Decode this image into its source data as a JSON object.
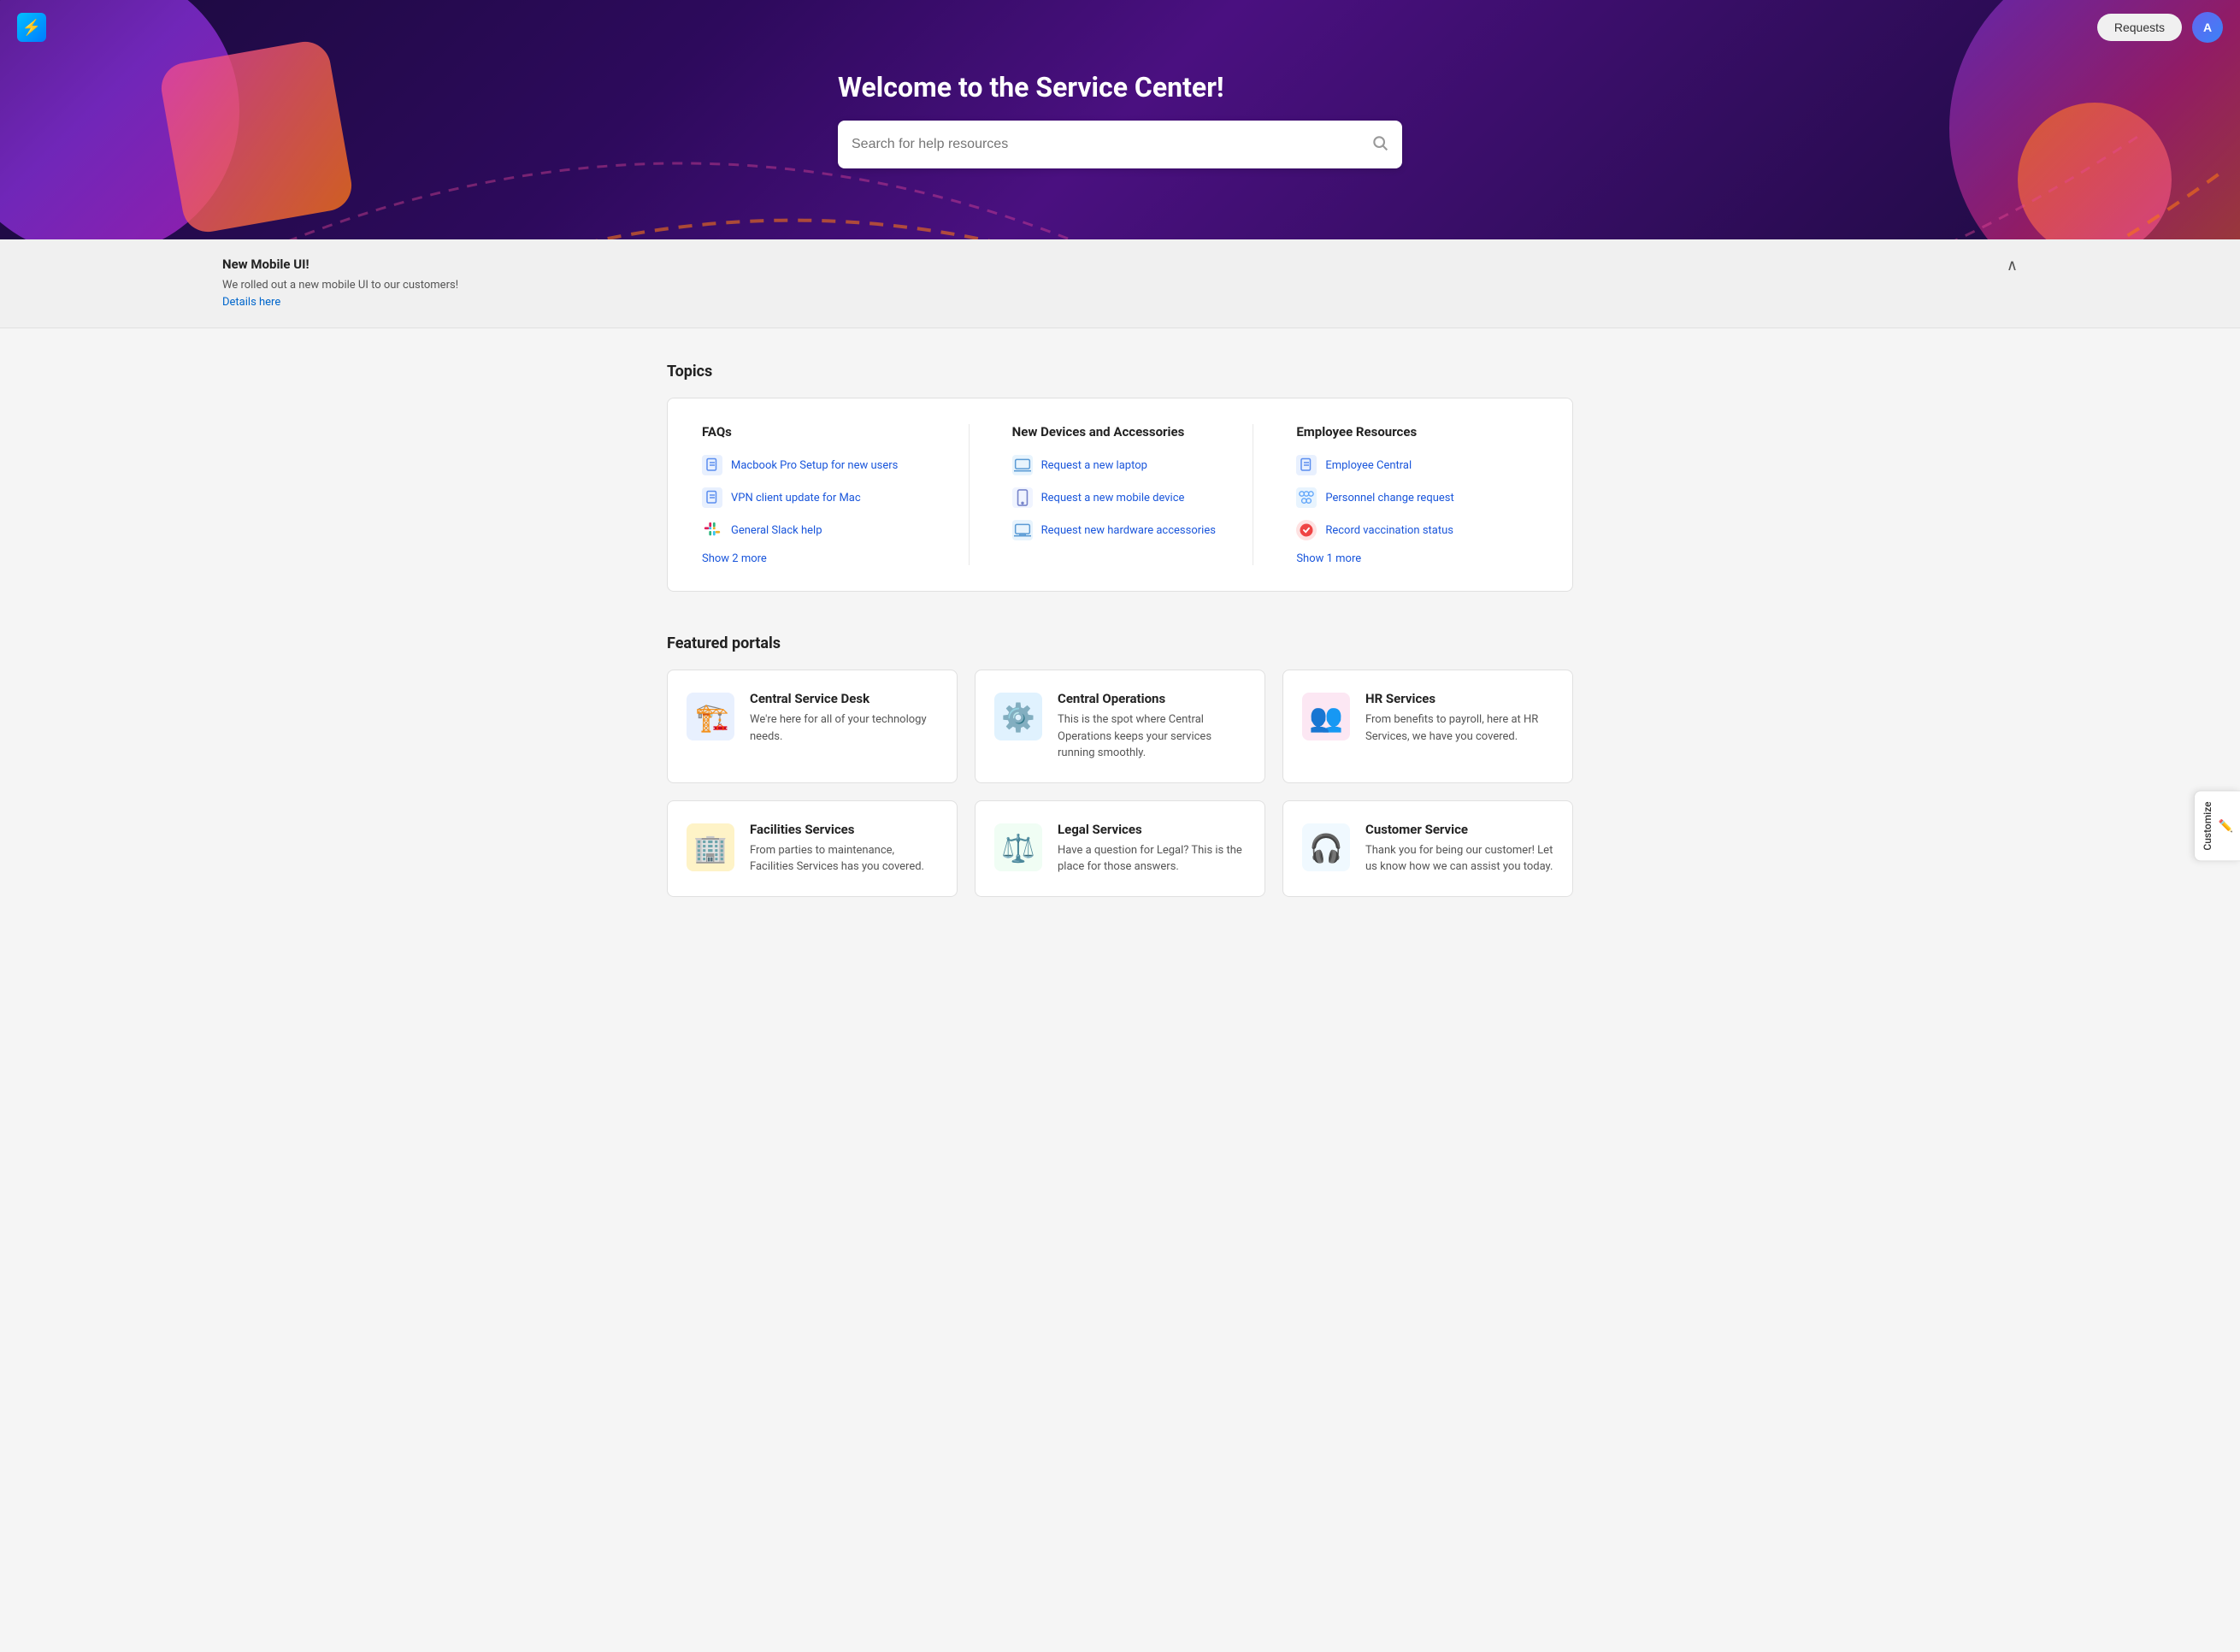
{
  "nav": {
    "logo_symbol": "⚡",
    "requests_label": "Requests",
    "avatar_label": "A",
    "customize_label": "Customize"
  },
  "hero": {
    "title": "Welcome to the Service Center!",
    "search_placeholder": "Search for help resources"
  },
  "announcement": {
    "title": "New Mobile UI!",
    "body": "We rolled out a new mobile UI to our customers!",
    "link_text": "Details here",
    "toggle_icon": "∧"
  },
  "topics": {
    "section_title": "Topics",
    "columns": [
      {
        "title": "FAQs",
        "items": [
          {
            "label": "Macbook Pro Setup for new users",
            "icon": "doc"
          },
          {
            "label": "VPN client update for Mac",
            "icon": "doc"
          },
          {
            "label": "General Slack help",
            "icon": "slack"
          }
        ],
        "show_more": "Show 2 more"
      },
      {
        "title": "New Devices and Accessories",
        "items": [
          {
            "label": "Request a new laptop",
            "icon": "laptop"
          },
          {
            "label": "Request a new mobile device",
            "icon": "phone"
          },
          {
            "label": "Request new hardware accessories",
            "icon": "hardware"
          }
        ],
        "show_more": null
      },
      {
        "title": "Employee Resources",
        "items": [
          {
            "label": "Employee Central",
            "icon": "employee"
          },
          {
            "label": "Personnel change request",
            "icon": "personnel"
          },
          {
            "label": "Record vaccination status",
            "icon": "vaccination"
          }
        ],
        "show_more": "Show 1 more"
      }
    ]
  },
  "featured_portals": {
    "section_title": "Featured portals",
    "portals": [
      {
        "name": "Central Service Desk",
        "desc": "We're here for all of your technology needs.",
        "icon": "🏗️"
      },
      {
        "name": "Central Operations",
        "desc": "This is the spot where Central Operations keeps your services running smoothly.",
        "icon": "⚙️"
      },
      {
        "name": "HR Services",
        "desc": "From benefits to payroll, here at HR Services, we have you covered.",
        "icon": "👥"
      },
      {
        "name": "Facilities Services",
        "desc": "From parties to maintenance, Facilities Services has you covered.",
        "icon": "🏢"
      },
      {
        "name": "Legal Services",
        "desc": "Have a question for Legal? This is the place for those answers.",
        "icon": "⚖️"
      },
      {
        "name": "Customer Service",
        "desc": "Thank you for being our customer! Let us know how we can assist you today.",
        "icon": "🎧"
      }
    ]
  }
}
